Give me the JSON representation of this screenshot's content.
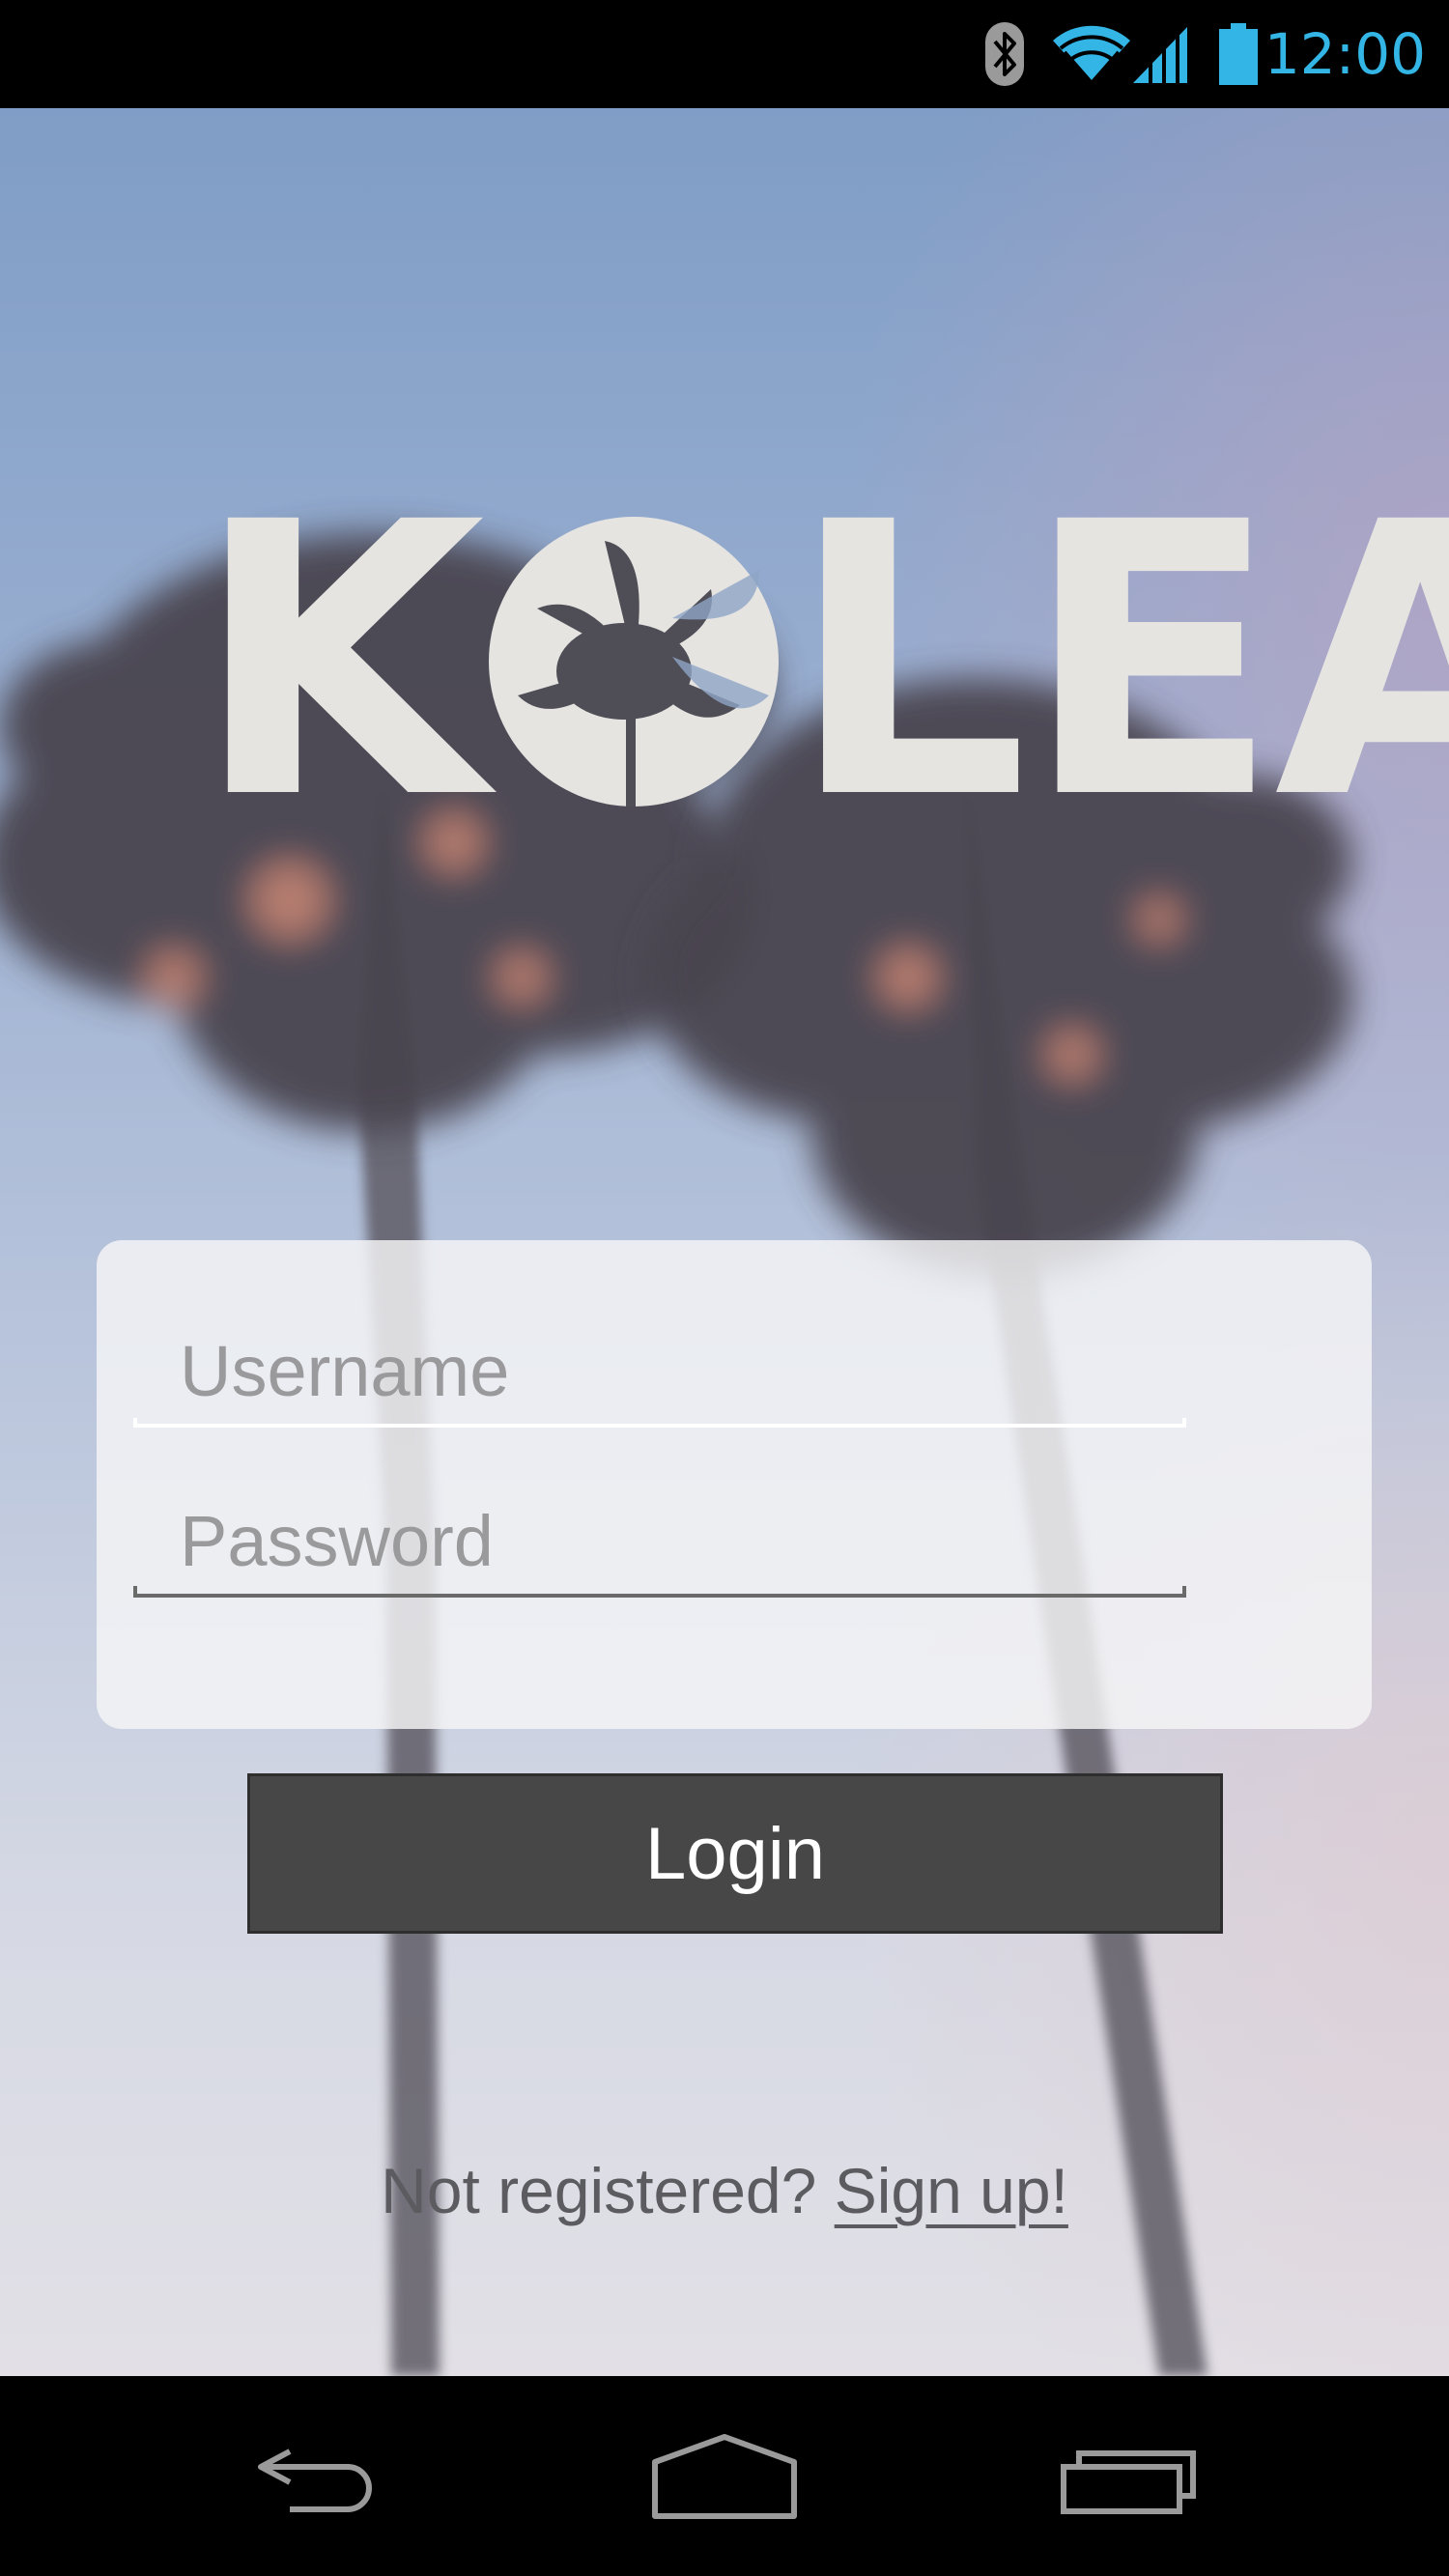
{
  "status_bar": {
    "time": "12:00",
    "icons": [
      "bluetooth-icon",
      "wifi-icon",
      "cell-signal-icon",
      "battery-icon"
    ],
    "clock_color": "#33b5e5"
  },
  "app": {
    "logo_text": "KOLEA"
  },
  "login_form": {
    "username_placeholder": "Username",
    "password_placeholder": "Password",
    "login_label": "Login"
  },
  "signup": {
    "prompt": "Not registered? ",
    "link_label": "Sign up!"
  },
  "nav_bar": {
    "icons": [
      "back-icon",
      "home-icon",
      "recents-icon"
    ]
  },
  "colors": {
    "button_bg": "#474747",
    "text_muted": "#5b5b60",
    "logo": "#e5e4e1"
  }
}
